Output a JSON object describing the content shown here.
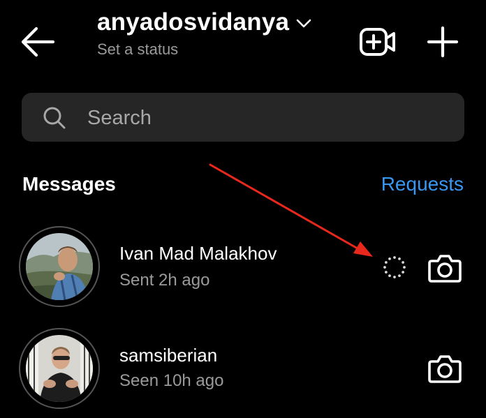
{
  "header": {
    "username": "anyadosvidanya",
    "status": "Set a status"
  },
  "search": {
    "placeholder": "Search"
  },
  "messages": {
    "section_title": "Messages",
    "requests_label": "Requests",
    "threads": [
      {
        "name": "Ivan Mad Malakhov",
        "subtitle": "Sent 2h ago",
        "status_icon": "loading-icon"
      },
      {
        "name": "samsiberian",
        "subtitle": "Seen 10h ago"
      }
    ]
  },
  "icons": {
    "back": "back-arrow-icon",
    "dropdown": "chevron-down-icon",
    "video": "video-call-icon",
    "new": "plus-icon",
    "search": "search-icon",
    "camera": "camera-icon"
  },
  "colors": {
    "background": "#000000",
    "search_bg": "#262626",
    "link": "#3897f0",
    "secondary_text": "#9a9a9a",
    "annotation_arrow": "#e8281c"
  }
}
